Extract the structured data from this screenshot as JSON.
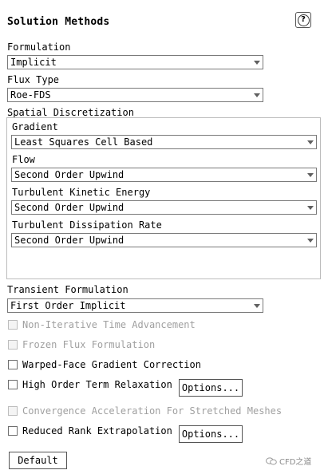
{
  "panel": {
    "title": "Solution Methods",
    "help_glyph": "?"
  },
  "formulation": {
    "label": "Formulation",
    "value": "Implicit"
  },
  "flux_type": {
    "label": "Flux Type",
    "value": "Roe-FDS"
  },
  "spatial": {
    "label": "Spatial Discretization",
    "gradient": {
      "label": "Gradient",
      "value": "Least Squares Cell Based"
    },
    "flow": {
      "label": "Flow",
      "value": "Second Order Upwind"
    },
    "tke": {
      "label": "Turbulent Kinetic Energy",
      "value": "Second Order Upwind"
    },
    "tdr": {
      "label": "Turbulent Dissipation Rate",
      "value": "Second Order Upwind"
    }
  },
  "transient": {
    "label": "Transient Formulation",
    "value": "First Order Implicit"
  },
  "options": {
    "nita": {
      "label": "Non-Iterative Time Advancement",
      "checked": false,
      "enabled": false
    },
    "frozen_flux": {
      "label": "Frozen Flux Formulation",
      "checked": false,
      "enabled": false
    },
    "warped_face": {
      "label": "Warped-Face Gradient Correction",
      "checked": false,
      "enabled": true
    },
    "hotr": {
      "label": "High Order Term Relaxation",
      "checked": false,
      "enabled": true,
      "button": "Options..."
    },
    "convergence_accel": {
      "label": "Convergence Acceleration For Stretched Meshes",
      "checked": false,
      "enabled": false
    },
    "rre": {
      "label": "Reduced Rank Extrapolation",
      "checked": false,
      "enabled": true,
      "button": "Options..."
    }
  },
  "default_button": "Default",
  "watermark": {
    "text": "CFD之道",
    "icon": "wechat-icon"
  }
}
